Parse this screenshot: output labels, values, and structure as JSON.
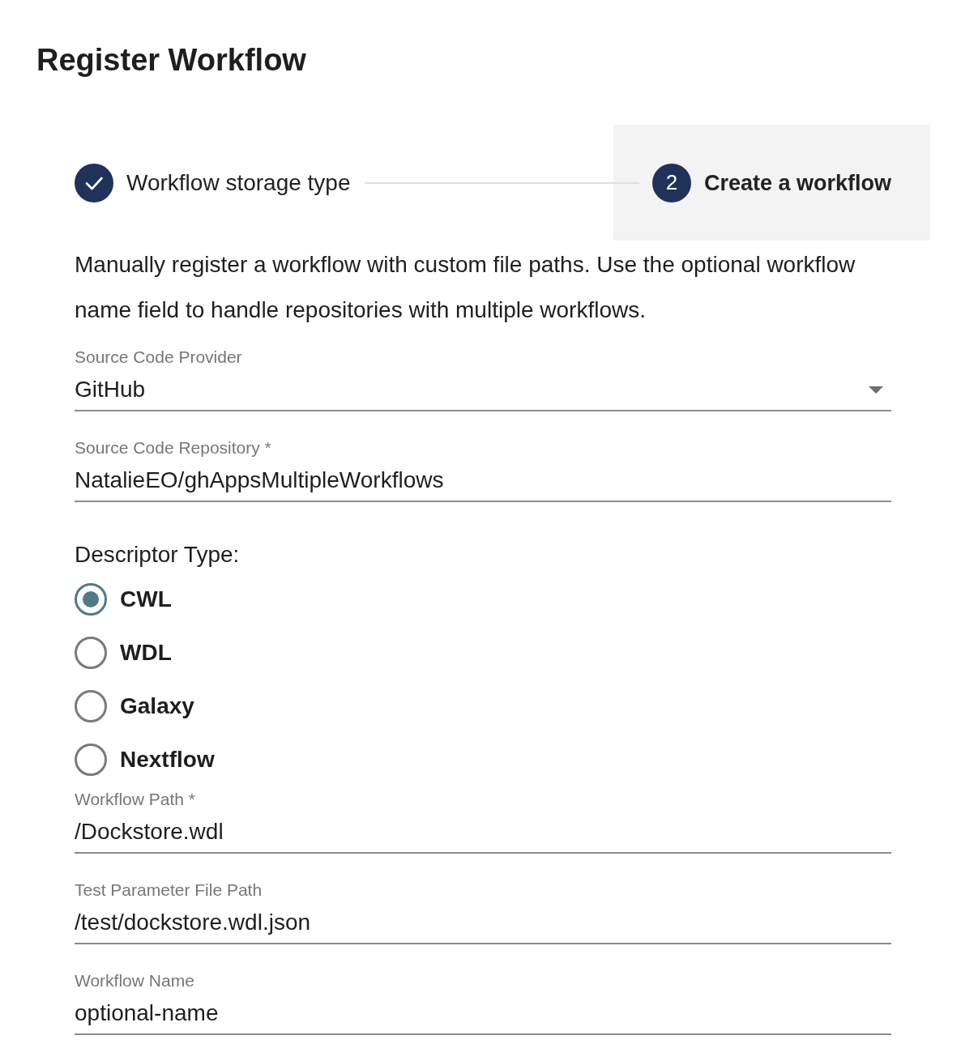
{
  "page": {
    "title": "Register Workflow"
  },
  "stepper": [
    {
      "kind": "done",
      "label": "Workflow storage type",
      "selected": false
    },
    {
      "kind": "numbered",
      "number": "2",
      "label": "Create a workflow",
      "selected": true
    }
  ],
  "description": "Manually register a workflow with custom file paths. Use the optional workflow name field to handle repositories with multiple workflows.",
  "form": [
    {
      "kind": "select",
      "label": "Source Code Provider",
      "value": "GitHub"
    },
    {
      "kind": "text",
      "label": "Source Code Repository *",
      "value": "NatalieEO/ghAppsMultipleWorkflows"
    },
    {
      "kind": "radio",
      "label": "Descriptor Type:",
      "options": [
        {
          "label": "CWL",
          "selected": true
        },
        {
          "label": "WDL",
          "selected": false
        },
        {
          "label": "Galaxy",
          "selected": false
        },
        {
          "label": "Nextflow",
          "selected": false
        }
      ]
    },
    {
      "kind": "text",
      "label": "Workflow Path *",
      "value": "/Dockstore.wdl"
    },
    {
      "kind": "text",
      "label": "Test Parameter File Path",
      "value": "/test/dockstore.wdl.json"
    },
    {
      "kind": "text",
      "label": "Workflow Name",
      "value": "optional-name"
    }
  ]
}
